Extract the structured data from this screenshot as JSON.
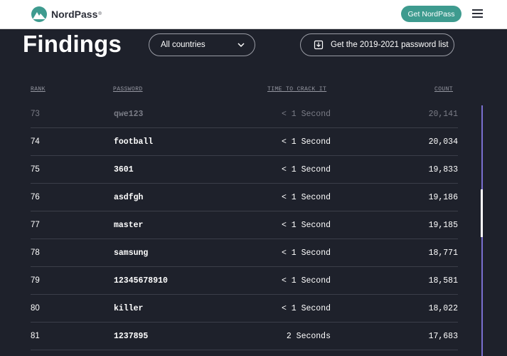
{
  "header": {
    "brand": "NordPass",
    "brand_mark": "®",
    "cta_label": "Get NordPass"
  },
  "page": {
    "title": "Findings",
    "country_filter": "All countries",
    "download_label": "Get the 2019-2021 password list"
  },
  "table": {
    "columns": [
      "RANK",
      "PASSWORD",
      "TIME TO CRACK IT",
      "COUNT"
    ],
    "rows": [
      {
        "rank": "73",
        "password": "qwe123",
        "time": "< 1 Second",
        "count": "20,141"
      },
      {
        "rank": "74",
        "password": "football",
        "time": "< 1 Second",
        "count": "20,034"
      },
      {
        "rank": "75",
        "password": "3601",
        "time": "< 1 Second",
        "count": "19,833"
      },
      {
        "rank": "76",
        "password": "asdfgh",
        "time": "< 1 Second",
        "count": "19,186"
      },
      {
        "rank": "77",
        "password": "master",
        "time": "< 1 Second",
        "count": "19,185"
      },
      {
        "rank": "78",
        "password": "samsung",
        "time": "< 1 Second",
        "count": "18,771"
      },
      {
        "rank": "79",
        "password": "12345678910",
        "time": "< 1 Second",
        "count": "18,581"
      },
      {
        "rank": "80",
        "password": "killer",
        "time": "< 1 Second",
        "count": "18,022"
      },
      {
        "rank": "81",
        "password": "1237895",
        "time": "2 Seconds",
        "count": "17,683"
      }
    ]
  },
  "icons": {
    "logo": "nordpass-mountain-icon",
    "menu": "hamburger-menu-icon",
    "select": "chevron-down-icon",
    "download": "download-icon"
  },
  "colors": {
    "background": "#1e212b",
    "accent": "#3e9b8f",
    "scrollbar": "#7a6fd0"
  }
}
